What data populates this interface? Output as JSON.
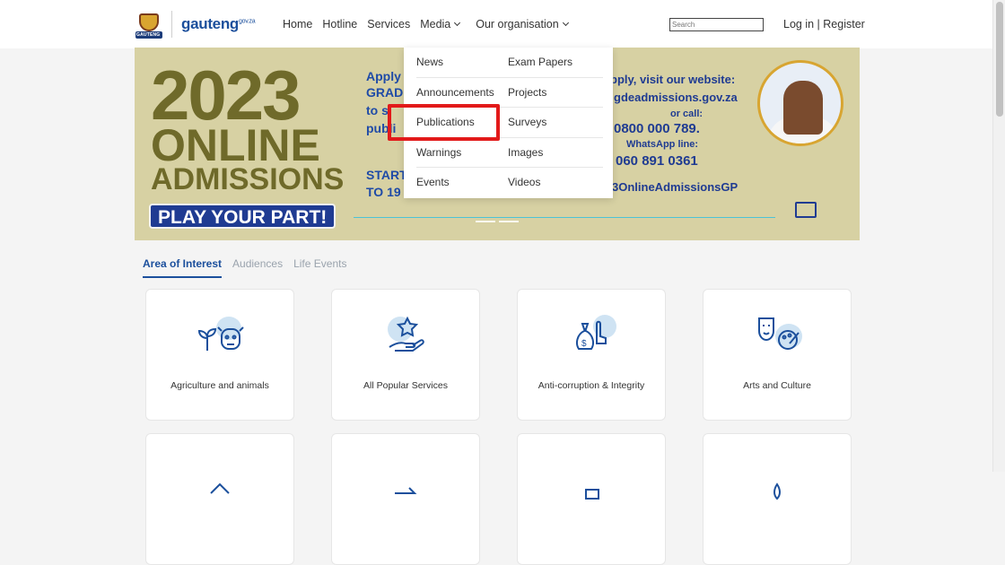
{
  "header": {
    "crest_text": "GAUTENG",
    "brand": "gauteng",
    "brand_suffix": "gov.za",
    "nav": [
      "Home",
      "Hotline",
      "Services",
      "Media",
      "Our organisation"
    ],
    "search_placeholder": "Search",
    "login": "Log in",
    "divider": "|",
    "register": "Register"
  },
  "banner": {
    "year": "2023",
    "line1": "ONLINE",
    "line2": "ADMISSIONS",
    "cta": "PLAY YOUR PART!",
    "apply": "Apply",
    "grad": "GRAD",
    "to_s": "to s",
    "publi": "publi",
    "start": "START",
    "to19": "TO 19",
    "visit": "pply, visit our website:",
    "website": "gdeadmissions.gov.za",
    "or_call": "or call:",
    "phone": "0800 000 789.",
    "whatsapp_label": "WhatsApp line:",
    "whatsapp": "060 891 0361",
    "hashtag": "3OnlineAdmissionsGP"
  },
  "media_menu": {
    "col1": [
      "News",
      "Announcements",
      "Publications",
      "Warnings",
      "Events"
    ],
    "col2": [
      "Exam Papers",
      "Projects",
      "Surveys",
      "Images",
      "Videos"
    ],
    "highlighted": "Publications"
  },
  "tabs": [
    "Area of Interest",
    "Audiences",
    "Life Events"
  ],
  "cards": [
    {
      "label": "Agriculture and animals",
      "icon": "plant-cow-icon"
    },
    {
      "label": "All Popular Services",
      "icon": "star-hand-icon"
    },
    {
      "label": "Anti-corruption & Integrity",
      "icon": "money-bag-icon"
    },
    {
      "label": "Arts and Culture",
      "icon": "masks-palette-icon"
    }
  ],
  "colors": {
    "accent": "#1b4f9c",
    "highlight": "#e21a1a",
    "banner_bg": "#d7d1a3"
  }
}
